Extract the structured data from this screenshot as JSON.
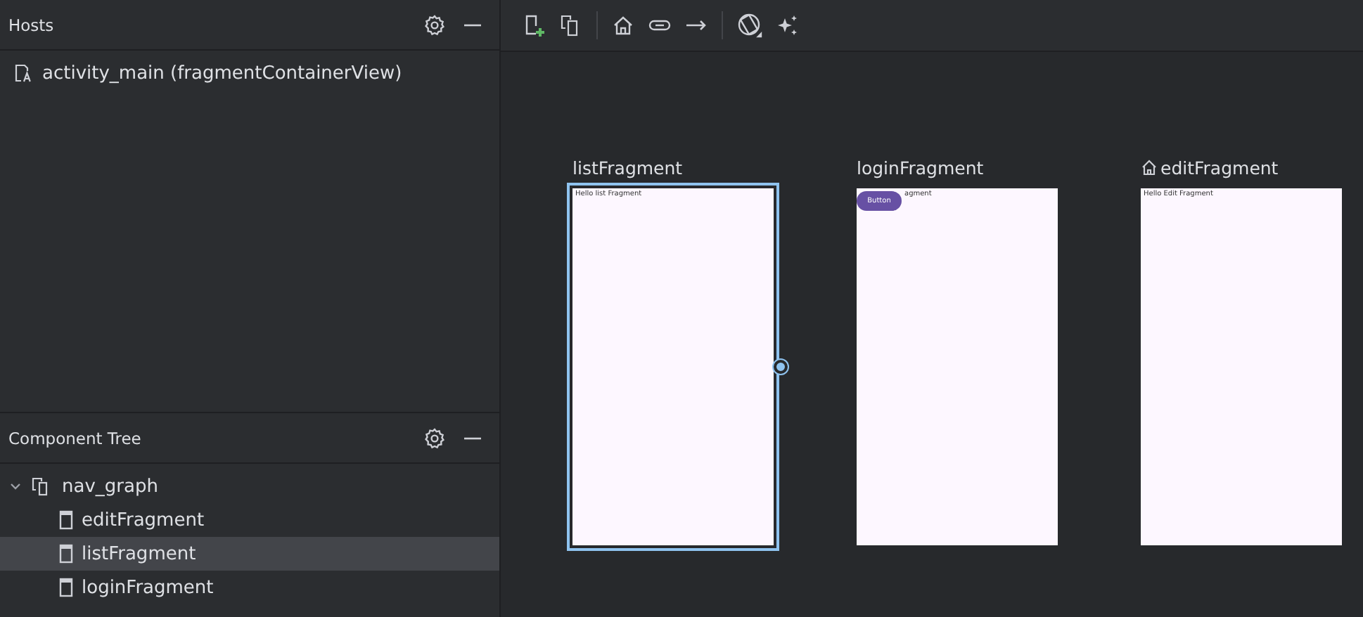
{
  "hosts": {
    "title": "Hosts",
    "items": [
      {
        "label": "activity_main (fragmentContainerView)"
      }
    ]
  },
  "component_tree": {
    "title": "Component Tree",
    "root": {
      "label": "nav_graph",
      "expanded": true,
      "children": [
        {
          "label": "editFragment",
          "selected": false
        },
        {
          "label": "listFragment",
          "selected": true
        },
        {
          "label": "loginFragment",
          "selected": false
        }
      ]
    }
  },
  "destinations": [
    {
      "label": "listFragment",
      "start": false,
      "selected": true,
      "preview_text": "Hello list Fragment"
    },
    {
      "label": "loginFragment",
      "start": false,
      "selected": false,
      "preview_text": "agment",
      "preview_button": "Button"
    },
    {
      "label": "editFragment",
      "start": true,
      "selected": false,
      "preview_text": "Hello Edit Fragment"
    }
  ]
}
